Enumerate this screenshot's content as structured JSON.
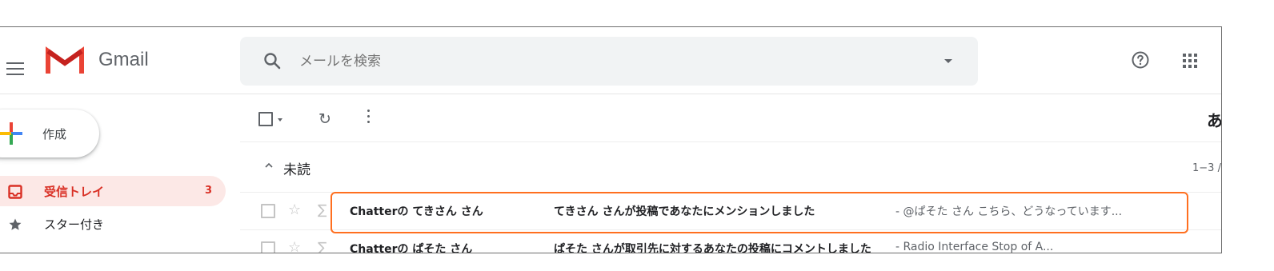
{
  "header": {
    "app_name": "Gmail",
    "search_placeholder": "メールを検索"
  },
  "compose": {
    "label": "作成"
  },
  "sidebar": {
    "items": [
      {
        "label": "受信トレイ",
        "count": "3",
        "active": true,
        "icon": "inbox-icon"
      },
      {
        "label": "スター付き",
        "count": "",
        "active": false,
        "icon": "star-icon"
      }
    ]
  },
  "toolbar": {
    "right_text": "あ"
  },
  "section": {
    "title": "未読",
    "range": "1−3 /"
  },
  "emails": [
    {
      "sender": "Chatterの てきさん さん",
      "subject": "てきさん さんが投稿であなたにメンションしました",
      "snippet": " - @ぱそた さん こちら、どうなっています..."
    },
    {
      "sender": "Chatterの ぱそた さん",
      "subject": "ぱそた さんが取引先に対するあなたの投稿にコメントしました",
      "snippet": " - Radio Interface Stop of A..."
    }
  ],
  "colors": {
    "gmail_red": "#ea4335",
    "inbox_active_bg": "#fce8e6",
    "inbox_active_text": "#d93025",
    "highlight": "#ff6f1f"
  }
}
